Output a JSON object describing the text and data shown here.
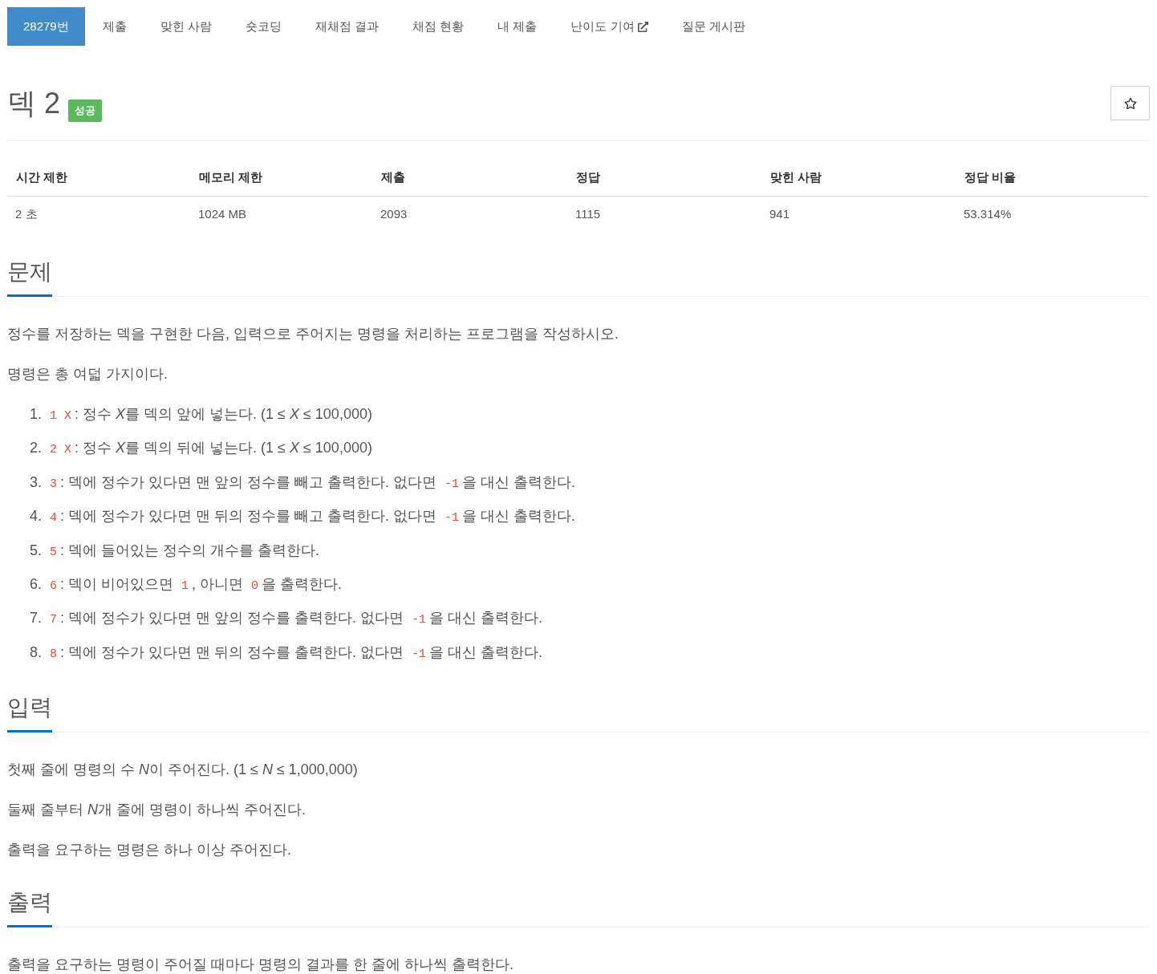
{
  "tabs": [
    {
      "label": "28279번",
      "selected": true,
      "external": false
    },
    {
      "label": "제출",
      "selected": false,
      "external": false
    },
    {
      "label": "맞힌 사람",
      "selected": false,
      "external": false
    },
    {
      "label": "숏코딩",
      "selected": false,
      "external": false
    },
    {
      "label": "재채점 결과",
      "selected": false,
      "external": false
    },
    {
      "label": "채점 현황",
      "selected": false,
      "external": false
    },
    {
      "label": "내 제출",
      "selected": false,
      "external": false
    },
    {
      "label": "난이도 기여",
      "selected": false,
      "external": true
    },
    {
      "label": "질문 게시판",
      "selected": false,
      "external": false
    }
  ],
  "problem": {
    "title": "덱 2",
    "badge": "성공",
    "starred": false
  },
  "stats_table": {
    "columns": [
      "시간 제한",
      "메모리 제한",
      "제출",
      "정답",
      "맞힌 사람",
      "정답 비율"
    ],
    "rows": [
      [
        "2 초",
        "1024 MB",
        "2093",
        "1115",
        "941",
        "53.314%"
      ]
    ]
  },
  "sections": [
    {
      "heading": "문제",
      "blocks": [
        {
          "kind": "paragraph",
          "runs": [
            {
              "text": "정수를 저장하는 덱을 구현한 다음, 입력으로 주어지는 명령을 처리하는 프로그램을 작성하시오.",
              "italic": false
            }
          ]
        },
        {
          "kind": "paragraph",
          "runs": [
            {
              "text": "명령은 총 여덟 가지이다.",
              "italic": false
            }
          ]
        },
        {
          "kind": "list",
          "items": [
            {
              "number": "1.",
              "parts": [
                {
                  "kind": "code",
                  "text": "1 X"
                },
                {
                  "kind": "text",
                  "runs": [
                    {
                      "text": ": 정수 ",
                      "italic": false
                    },
                    {
                      "text": "X",
                      "italic": true
                    },
                    {
                      "text": "를 덱의 앞에 넣는다. (1 ≤ ",
                      "italic": false
                    },
                    {
                      "text": "X",
                      "italic": true
                    },
                    {
                      "text": " ≤ 100,000)",
                      "italic": false
                    }
                  ]
                }
              ]
            },
            {
              "number": "2.",
              "parts": [
                {
                  "kind": "code",
                  "text": "2 X"
                },
                {
                  "kind": "text",
                  "runs": [
                    {
                      "text": ": 정수 ",
                      "italic": false
                    },
                    {
                      "text": "X",
                      "italic": true
                    },
                    {
                      "text": "를 덱의 뒤에 넣는다. (1 ≤ ",
                      "italic": false
                    },
                    {
                      "text": "X",
                      "italic": true
                    },
                    {
                      "text": " ≤ 100,000)",
                      "italic": false
                    }
                  ]
                }
              ]
            },
            {
              "number": "3.",
              "parts": [
                {
                  "kind": "code",
                  "text": "3"
                },
                {
                  "kind": "text",
                  "runs": [
                    {
                      "text": ": 덱에 정수가 있다면 맨 앞의 정수를 빼고 출력한다. 없다면",
                      "italic": false
                    }
                  ]
                },
                {
                  "kind": "code",
                  "text": "-1"
                },
                {
                  "kind": "text",
                  "runs": [
                    {
                      "text": "을 대신 출력한다.",
                      "italic": false
                    }
                  ]
                }
              ]
            },
            {
              "number": "4.",
              "parts": [
                {
                  "kind": "code",
                  "text": "4"
                },
                {
                  "kind": "text",
                  "runs": [
                    {
                      "text": ": 덱에 정수가 있다면 맨 뒤의 정수를 빼고 출력한다. 없다면",
                      "italic": false
                    }
                  ]
                },
                {
                  "kind": "code",
                  "text": "-1"
                },
                {
                  "kind": "text",
                  "runs": [
                    {
                      "text": "을 대신 출력한다.",
                      "italic": false
                    }
                  ]
                }
              ]
            },
            {
              "number": "5.",
              "parts": [
                {
                  "kind": "code",
                  "text": "5"
                },
                {
                  "kind": "text",
                  "runs": [
                    {
                      "text": ": 덱에 들어있는 정수의 개수를 출력한다.",
                      "italic": false
                    }
                  ]
                }
              ]
            },
            {
              "number": "6.",
              "parts": [
                {
                  "kind": "code",
                  "text": "6"
                },
                {
                  "kind": "text",
                  "runs": [
                    {
                      "text": ": 덱이 비어있으면",
                      "italic": false
                    }
                  ]
                },
                {
                  "kind": "code",
                  "text": "1"
                },
                {
                  "kind": "text",
                  "runs": [
                    {
                      "text": ", 아니면",
                      "italic": false
                    }
                  ]
                },
                {
                  "kind": "code",
                  "text": "0"
                },
                {
                  "kind": "text",
                  "runs": [
                    {
                      "text": "을 출력한다.",
                      "italic": false
                    }
                  ]
                }
              ]
            },
            {
              "number": "7.",
              "parts": [
                {
                  "kind": "code",
                  "text": "7"
                },
                {
                  "kind": "text",
                  "runs": [
                    {
                      "text": ": 덱에 정수가 있다면 맨 앞의 정수를 출력한다. 없다면",
                      "italic": false
                    }
                  ]
                },
                {
                  "kind": "code",
                  "text": "-1"
                },
                {
                  "kind": "text",
                  "runs": [
                    {
                      "text": "을 대신 출력한다.",
                      "italic": false
                    }
                  ]
                }
              ]
            },
            {
              "number": "8.",
              "parts": [
                {
                  "kind": "code",
                  "text": "8"
                },
                {
                  "kind": "text",
                  "runs": [
                    {
                      "text": ": 덱에 정수가 있다면 맨 뒤의 정수를 출력한다. 없다면",
                      "italic": false
                    }
                  ]
                },
                {
                  "kind": "code",
                  "text": "-1"
                },
                {
                  "kind": "text",
                  "runs": [
                    {
                      "text": "을 대신 출력한다.",
                      "italic": false
                    }
                  ]
                }
              ]
            }
          ]
        }
      ]
    },
    {
      "heading": "입력",
      "blocks": [
        {
          "kind": "paragraph",
          "runs": [
            {
              "text": "첫째 줄에 명령의 수 ",
              "italic": false
            },
            {
              "text": "N",
              "italic": true
            },
            {
              "text": "이 주어진다. (1 ≤ ",
              "italic": false
            },
            {
              "text": "N",
              "italic": true
            },
            {
              "text": " ≤ 1,000,000)",
              "italic": false
            }
          ]
        },
        {
          "kind": "paragraph",
          "runs": [
            {
              "text": "둘째 줄부터 ",
              "italic": false
            },
            {
              "text": "N",
              "italic": true
            },
            {
              "text": "개 줄에 명령이 하나씩 주어진다.",
              "italic": false
            }
          ]
        },
        {
          "kind": "paragraph",
          "runs": [
            {
              "text": "출력을 요구하는 명령은 하나 이상 주어진다.",
              "italic": false
            }
          ]
        }
      ]
    },
    {
      "heading": "출력",
      "blocks": [
        {
          "kind": "paragraph",
          "runs": [
            {
              "text": "출력을 요구하는 명령이 주어질 때마다 명령의 결과를 한 줄에 하나씩 출력한다.",
              "italic": false
            }
          ]
        }
      ]
    }
  ]
}
